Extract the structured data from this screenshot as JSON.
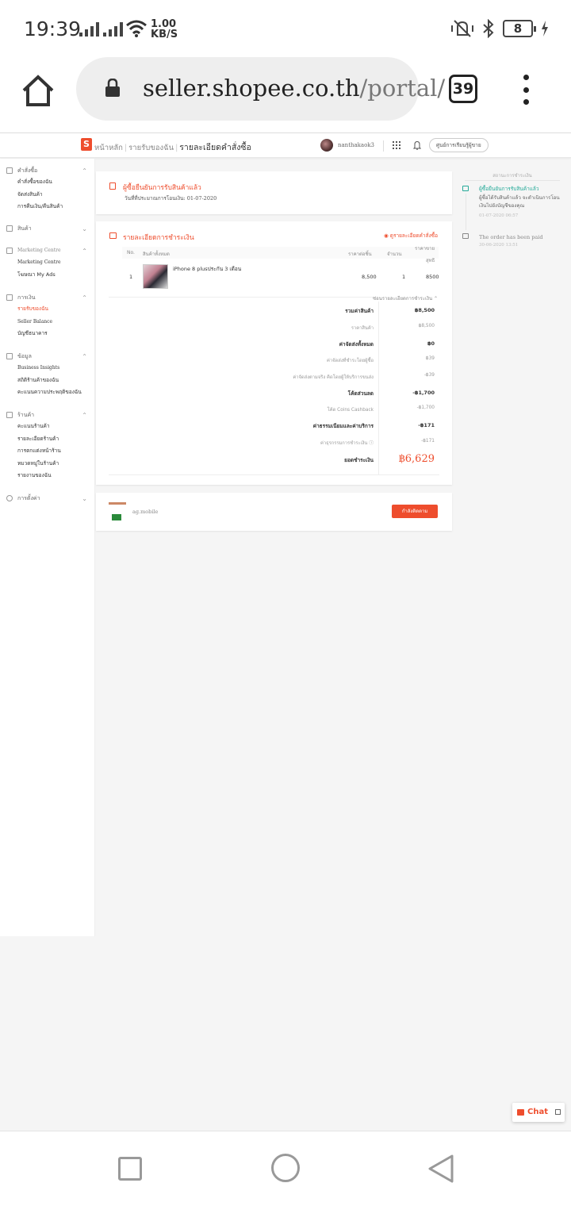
{
  "status_bar": {
    "time": "19:39",
    "net_speed_value": "1.00",
    "net_speed_unit": "KB/S",
    "battery": "8"
  },
  "browser": {
    "url_domain": "seller.shopee.co.th",
    "url_path": "/portal/",
    "tab_count": "39"
  },
  "topnav": {
    "logo_letter": "S",
    "breadcrumb": [
      "หน้าหลัก",
      "รายรับของฉัน",
      "รายละเอียดคำสั่งซื้อ"
    ],
    "username": "nanthakaok3",
    "help_label": "ศูนย์การเรียนรู้ผู้ขาย"
  },
  "sidebar": {
    "groups": [
      {
        "title": "คำสั่งซื้อ",
        "items": [
          "คำสั่งซื้อของฉัน",
          "จัดส่งสินค้า",
          "การคืนเงิน/คืนสินค้า"
        ]
      },
      {
        "title": "สินค้า",
        "items": []
      },
      {
        "title": "Marketing Centre",
        "items": [
          "Marketing Centre",
          "โฆษณา My Ads"
        ]
      },
      {
        "title": "การเงิน",
        "items": [
          "รายรับของฉัน",
          "Seller Balance",
          "บัญชีธนาคาร"
        ]
      },
      {
        "title": "ข้อมูล",
        "items": [
          "Business Insights",
          "สถิติร้านค้าของฉัน",
          "คะแนนความประพฤติของฉัน"
        ]
      },
      {
        "title": "ร้านค้า",
        "items": [
          "คะแนนร้านค้า",
          "รายละเอียดร้านค้า",
          "การตกแต่งหน้าร้าน",
          "หมวดหมู่ในร้านค้า",
          "รายงานของฉัน"
        ]
      },
      {
        "title": "การตั้งค่า",
        "items": []
      }
    ]
  },
  "status_card": {
    "title": "ผู้ซื้อยืนยันการรับสินค้าแล้ว",
    "subtitle": "วันที่ที่ประมาณการโอนเงิน: 01-07-2020"
  },
  "payment_card": {
    "title": "รายละเอียดการชำระเงิน",
    "order_link": "ดูรายละเอียดคำสั่งซื้อ",
    "headers": {
      "no": "No.",
      "product": "สินค้าทั้งหมด",
      "unit_price": "ราคาต่อชิ้น",
      "qty": "จำนวน",
      "subtotal": "ราคาขาย",
      "net": "สุทธิ"
    },
    "product": {
      "no": "1",
      "name": "iPhone 8 plusประกัน 3 เดือน",
      "unit_price": "8,500",
      "qty": "1",
      "subtotal": "8500"
    },
    "summary_toggle": "ซ่อนรายละเอียดการชำระเงิน",
    "summary": [
      {
        "label": "รวมค่าสินค้า",
        "value": "฿8,500",
        "kind": "main"
      },
      {
        "label": "ราคาสินค้า",
        "value": "฿8,500",
        "kind": "sub"
      },
      {
        "label": "ค่าจัดส่งทั้งหมด",
        "value": "฿0",
        "kind": "main"
      },
      {
        "label": "ค่าจัดส่งที่ชำระโดยผู้ซื้อ",
        "value": "฿39",
        "kind": "sub"
      },
      {
        "label": "ค่าจัดส่งตามจริง คิดโดยผู้ให้บริการขนส่ง",
        "value": "-฿39",
        "kind": "sub"
      },
      {
        "label": "โค้ดส่วนลด",
        "value": "-฿1,700",
        "kind": "main"
      },
      {
        "label": "โค้ด Coins Cashback",
        "value": "-฿1,700",
        "kind": "sub"
      },
      {
        "label": "ค่าธรรมเนียมและค่าบริการ",
        "value": "-฿171",
        "kind": "main"
      },
      {
        "label": "ค่าธุรกรรมการชำระเงิน ⓘ",
        "value": "-฿171",
        "kind": "sub"
      }
    ],
    "total_label": "ยอดชำระเงิน",
    "total_value": "฿6,629"
  },
  "buyer_card": {
    "name": "ag.mobile",
    "follow_label": "กำลังติดตาม"
  },
  "timeline": {
    "heading": "สถานะการชำระเงิน",
    "events": [
      {
        "title": "ผู้ซื้อยืนยันการรับสินค้าแล้ว",
        "desc": "ผู้ซื้อได้รับสินค้าแล้ว จะดำเนินการโอนเงินไปยังบัญชีของคุณ",
        "time": "01-07-2020 06:57"
      },
      {
        "title": "The order has been paid",
        "desc": "",
        "time": "30-06-2020 13:51"
      }
    ]
  },
  "chat": {
    "label": "Chat"
  },
  "colors": {
    "accent": "#ee4d2d",
    "teal": "#26aa99"
  }
}
